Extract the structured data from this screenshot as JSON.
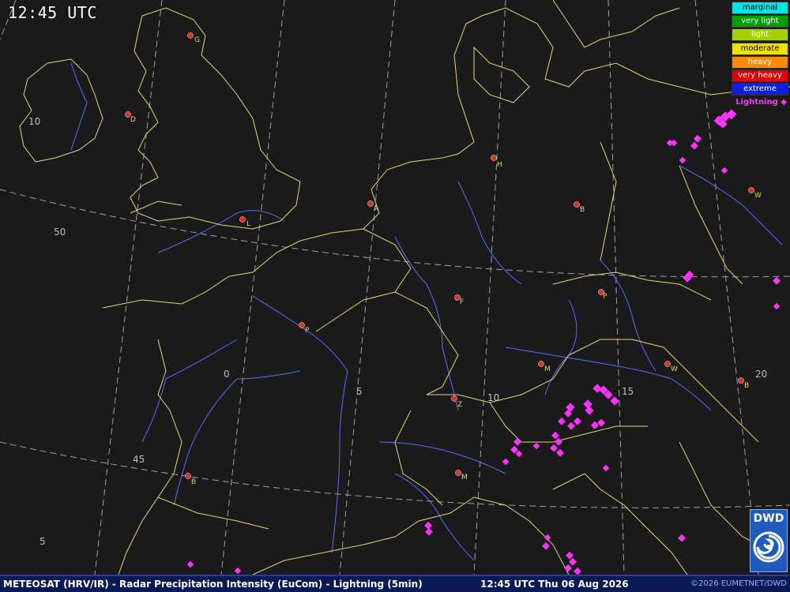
{
  "map": {
    "time": "12:45 UTC",
    "background_color": "#1a1a1a",
    "coastline_color": "#e8d27a",
    "river_color": "#5a6cff",
    "grid_color": "#cfcfcf"
  },
  "legend": {
    "items": [
      {
        "label": "marginal",
        "color": "#00e5e5"
      },
      {
        "label": "very light",
        "color": "#00a000"
      },
      {
        "label": "light",
        "color": "#a6d000"
      },
      {
        "label": "moderate",
        "color": "#f0e000"
      },
      {
        "label": "heavy",
        "color": "#ff8c00"
      },
      {
        "label": "very heavy",
        "color": "#e00000"
      },
      {
        "label": "extreme",
        "color": "#1020e0"
      }
    ],
    "lightning_label": "Lightning",
    "lightning_symbol": "◆",
    "lightning_color": "#ff33ff"
  },
  "grid_labels": {
    "lat": [
      "10",
      "50",
      "45",
      "5"
    ],
    "lon": [
      "0",
      "5",
      "10",
      "15",
      "20"
    ]
  },
  "cities": [
    {
      "label": "G"
    },
    {
      "label": "D"
    },
    {
      "label": "L"
    },
    {
      "label": "A"
    },
    {
      "label": "H"
    },
    {
      "label": "B"
    },
    {
      "label": "W"
    },
    {
      "label": "P"
    },
    {
      "label": "F"
    },
    {
      "label": "P"
    },
    {
      "label": "M"
    },
    {
      "label": "W"
    },
    {
      "label": "B"
    },
    {
      "label": "Z"
    },
    {
      "label": "M"
    },
    {
      "label": "B"
    }
  ],
  "footer": {
    "left": "METEOSAT (HRV/IR) - Radar Precipitation Intensity (EuCom) - Lightning (5min)",
    "center": "12:45 UTC Thu 06 Aug 2026",
    "right": "©2026 EUMETNET/DWD"
  },
  "logo": {
    "text": "DWD"
  }
}
